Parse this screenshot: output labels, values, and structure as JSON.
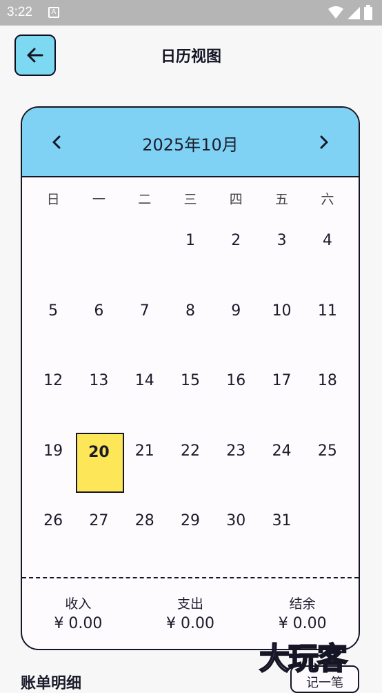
{
  "statusbar": {
    "time": "3:22",
    "notification_glyph": "A"
  },
  "header": {
    "title": "日历视图",
    "back_icon": "arrow-left-icon"
  },
  "calendar": {
    "month_title": "2025年10月",
    "weekdays": [
      "日",
      "一",
      "二",
      "三",
      "四",
      "五",
      "六"
    ],
    "leading_blanks": 3,
    "days": [
      "1",
      "2",
      "3",
      "4",
      "5",
      "6",
      "7",
      "8",
      "9",
      "10",
      "11",
      "12",
      "13",
      "14",
      "15",
      "16",
      "17",
      "18",
      "19",
      "20",
      "21",
      "22",
      "23",
      "24",
      "25",
      "26",
      "27",
      "28",
      "29",
      "30",
      "31"
    ],
    "selected_day": "20",
    "header_color": "#7fd2f3",
    "selected_color": "#fde758"
  },
  "summary": {
    "income_label": "收入",
    "income_value": "¥ 0.00",
    "expense_label": "支出",
    "expense_value": "¥ 0.00",
    "balance_label": "结余",
    "balance_value": "¥ 0.00"
  },
  "bottom": {
    "section_label": "账单明细",
    "button_label": "记一笔"
  },
  "watermark": "大玩客"
}
